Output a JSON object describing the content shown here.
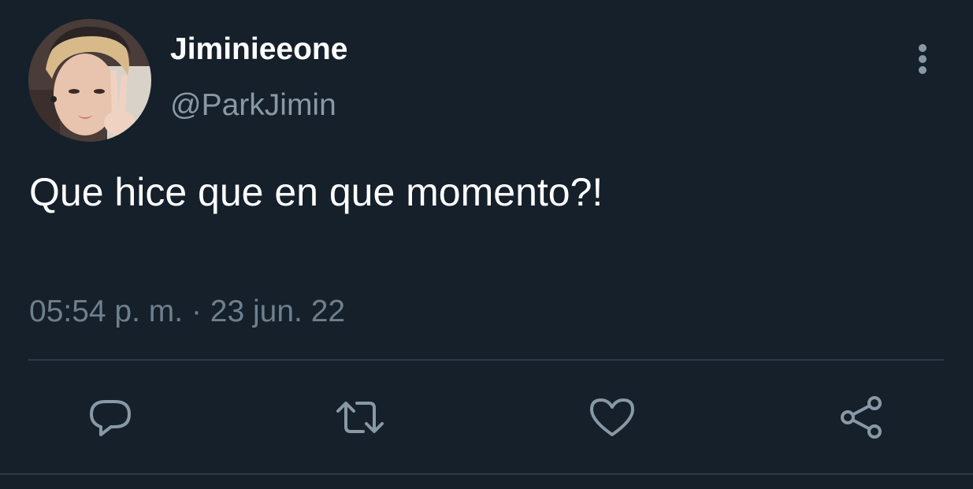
{
  "tweet": {
    "display_name": "Jiminieeone",
    "handle": "@ParkJimin",
    "text": "Que hice que en que momento?!",
    "timestamp": "05:54 p. m. · 23 jun. 22"
  },
  "icons": {
    "more": "more-vertical-icon",
    "reply": "reply-icon",
    "retweet": "retweet-icon",
    "like": "heart-icon",
    "share": "share-icon"
  },
  "colors": {
    "background": "#15202b",
    "primary_text": "#ffffff",
    "secondary_text": "#8899a6",
    "divider": "#2c3a47"
  }
}
